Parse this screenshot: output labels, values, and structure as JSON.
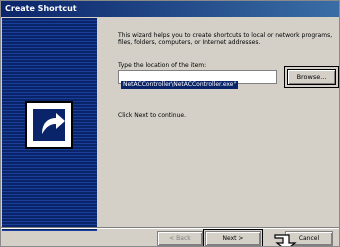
{
  "window": {
    "title": "Create Shortcut"
  },
  "wizard": {
    "intro": "This wizard helps you to create shortcuts to local or network programs, files, folders, computers, or Internet addresses.",
    "location_label": "Type the location of the item:",
    "location_value": "NetACController\\NetACController.exe\"",
    "browse_label": "Browse...",
    "next_hint": "Click Next to continue."
  },
  "buttons": {
    "back": "< Back",
    "next": "Next >",
    "cancel": "Cancel"
  },
  "icons": {
    "banner": "shortcut-arrow-icon",
    "pointer": "pointer-arrow-icon"
  },
  "colors": {
    "title_bar": "#0a246a",
    "banner": "#0a246a",
    "selection": "#0a246a",
    "dialog": "#d4d0c8"
  }
}
